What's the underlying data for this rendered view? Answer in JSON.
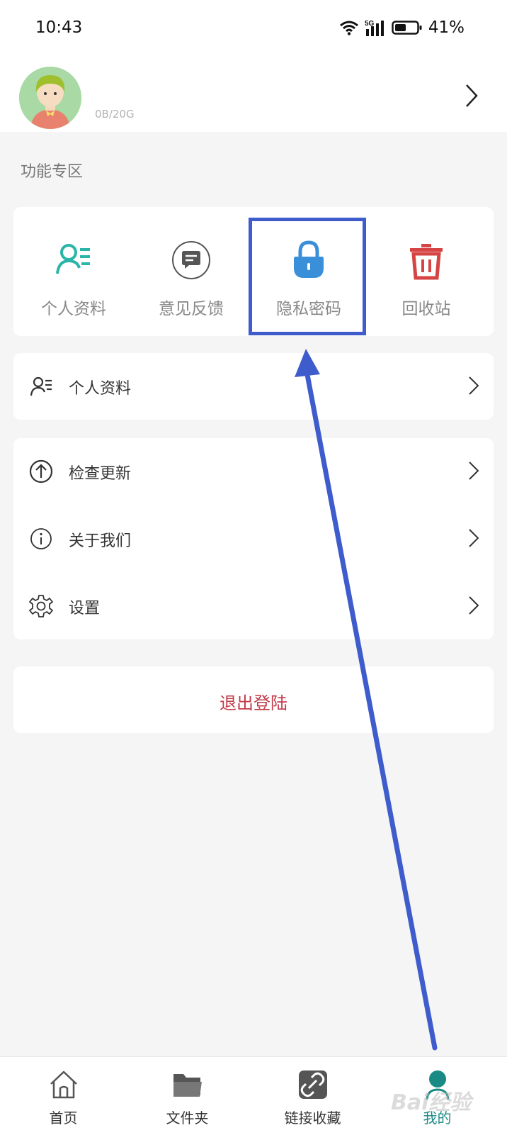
{
  "status_bar": {
    "time": "10:43",
    "network": "5G",
    "battery": "41%"
  },
  "profile": {
    "storage": "0B/20G"
  },
  "section_title": "功能专区",
  "features": [
    {
      "label": "个人资料",
      "icon": "person-list-icon",
      "color": "#2bb5a8"
    },
    {
      "label": "意见反馈",
      "icon": "chat-bubble-icon",
      "color": "#555555"
    },
    {
      "label": "隐私密码",
      "icon": "lock-icon",
      "color": "#3a8fd9"
    },
    {
      "label": "回收站",
      "icon": "trash-icon",
      "color": "#d64444"
    }
  ],
  "menu_group1": [
    {
      "label": "个人资料",
      "icon": "person-list-icon"
    }
  ],
  "menu_group2": [
    {
      "label": "检查更新",
      "icon": "upload-circle-icon"
    },
    {
      "label": "关于我们",
      "icon": "info-circle-icon"
    },
    {
      "label": "设置",
      "icon": "gear-icon"
    }
  ],
  "logout_label": "退出登陆",
  "tabs": [
    {
      "label": "首页",
      "icon": "home-icon"
    },
    {
      "label": "文件夹",
      "icon": "folder-icon"
    },
    {
      "label": "链接收藏",
      "icon": "link-icon"
    },
    {
      "label": "我的",
      "icon": "profile-icon",
      "active": true
    }
  ],
  "colors": {
    "accent": "#1a8b84",
    "logout": "#c33a4a",
    "annotation": "#3f5ccc"
  },
  "watermark": "Bai经验"
}
